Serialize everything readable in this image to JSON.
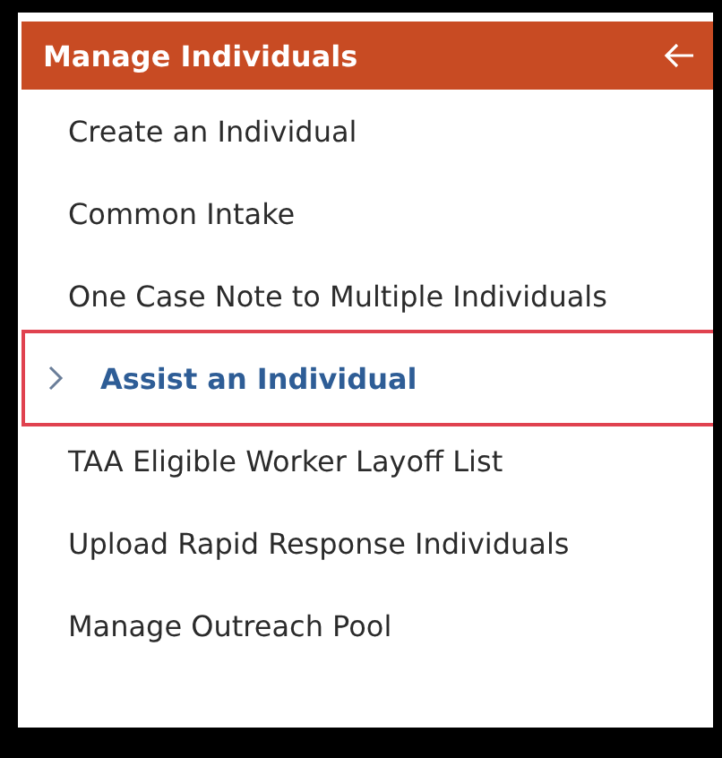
{
  "panel": {
    "title": "Manage Individuals"
  },
  "items": [
    {
      "label": "Create an Individual",
      "selected": false
    },
    {
      "label": "Common Intake",
      "selected": false
    },
    {
      "label": "One Case Note to Multiple Individuals",
      "selected": false
    },
    {
      "label": "Assist an Individual",
      "selected": true
    },
    {
      "label": "TAA Eligible Worker Layoff List",
      "selected": false
    },
    {
      "label": "Upload Rapid Response Individuals",
      "selected": false
    },
    {
      "label": "Manage Outreach Pool",
      "selected": false
    }
  ]
}
